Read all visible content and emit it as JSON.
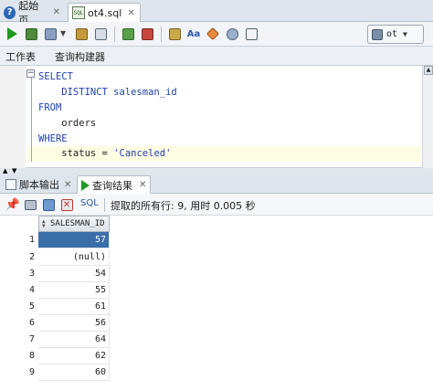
{
  "doc_tabs": [
    {
      "label": "起始页",
      "icon": "help-icon"
    },
    {
      "label": "ot4.sql",
      "icon": "sql-file-icon"
    }
  ],
  "toolbar": {
    "connection": "ot"
  },
  "sub_tabs": [
    "工作表",
    "查询构建器"
  ],
  "editor": {
    "lines": [
      {
        "kw": "SELECT",
        "rest": ""
      },
      {
        "kw": "",
        "rest": "    DISTINCT salesman_id"
      },
      {
        "kw": "FROM",
        "rest": ""
      },
      {
        "kw": "",
        "rest": "    orders"
      },
      {
        "kw": "WHERE",
        "rest": ""
      },
      {
        "kw": "",
        "rest": "    status = 'Canceled'"
      }
    ]
  },
  "output_tabs": [
    {
      "label": "脚本输出"
    },
    {
      "label": "查询结果"
    }
  ],
  "results": {
    "sql_label": "SQL",
    "status": "提取的所有行: 9, 用时 0.005 秒",
    "column": "SALESMAN_ID",
    "rows": [
      {
        "n": "1",
        "v": "57"
      },
      {
        "n": "2",
        "v": "(null)"
      },
      {
        "n": "3",
        "v": "54"
      },
      {
        "n": "4",
        "v": "55"
      },
      {
        "n": "5",
        "v": "61"
      },
      {
        "n": "6",
        "v": "56"
      },
      {
        "n": "7",
        "v": "64"
      },
      {
        "n": "8",
        "v": "62"
      },
      {
        "n": "9",
        "v": "60"
      }
    ]
  },
  "colors": {
    "selection": "#3a6ea8",
    "keyword": "#1f3fae",
    "run_green": "#1f9a22"
  }
}
